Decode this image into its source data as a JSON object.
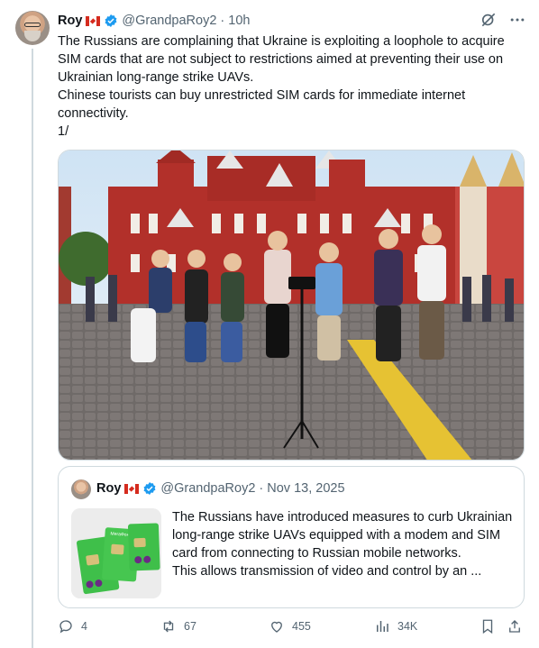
{
  "tweet": {
    "author_name": "Roy",
    "handle": "@GrandpaRoy2",
    "separator": "·",
    "time": "10h",
    "text_lines": [
      "The Russians are complaining that Ukraine is exploiting a loophole to acquire SIM cards that are not subject to restrictions aimed at preventing their use on Ukrainian long-range strike UAVs.",
      "Chinese tourists can buy unrestricted SIM cards for immediate internet connectivity.",
      "1/"
    ]
  },
  "quote": {
    "author_name": "Roy",
    "handle": "@GrandpaRoy2",
    "separator": "·",
    "date": "Nov 13, 2025",
    "text": "The Russians have introduced measures to curb Ukrainian long-range strike UAVs equipped with a modem and SIM card from connecting to Russian mobile networks.",
    "text2": "This allows transmission of video and control by an ...",
    "sim_brand": "МегаФон"
  },
  "actions": {
    "replies": "4",
    "reposts": "67",
    "likes": "455",
    "views": "34K"
  },
  "icons": [
    "grok-icon",
    "more-icon",
    "verified-icon",
    "reply-icon",
    "repost-icon",
    "like-icon",
    "views-icon",
    "bookmark-icon",
    "share-icon"
  ],
  "colors": {
    "verified": "#1d9bf0",
    "sim_green": "#3fbf4a",
    "text_secondary": "#536471"
  }
}
